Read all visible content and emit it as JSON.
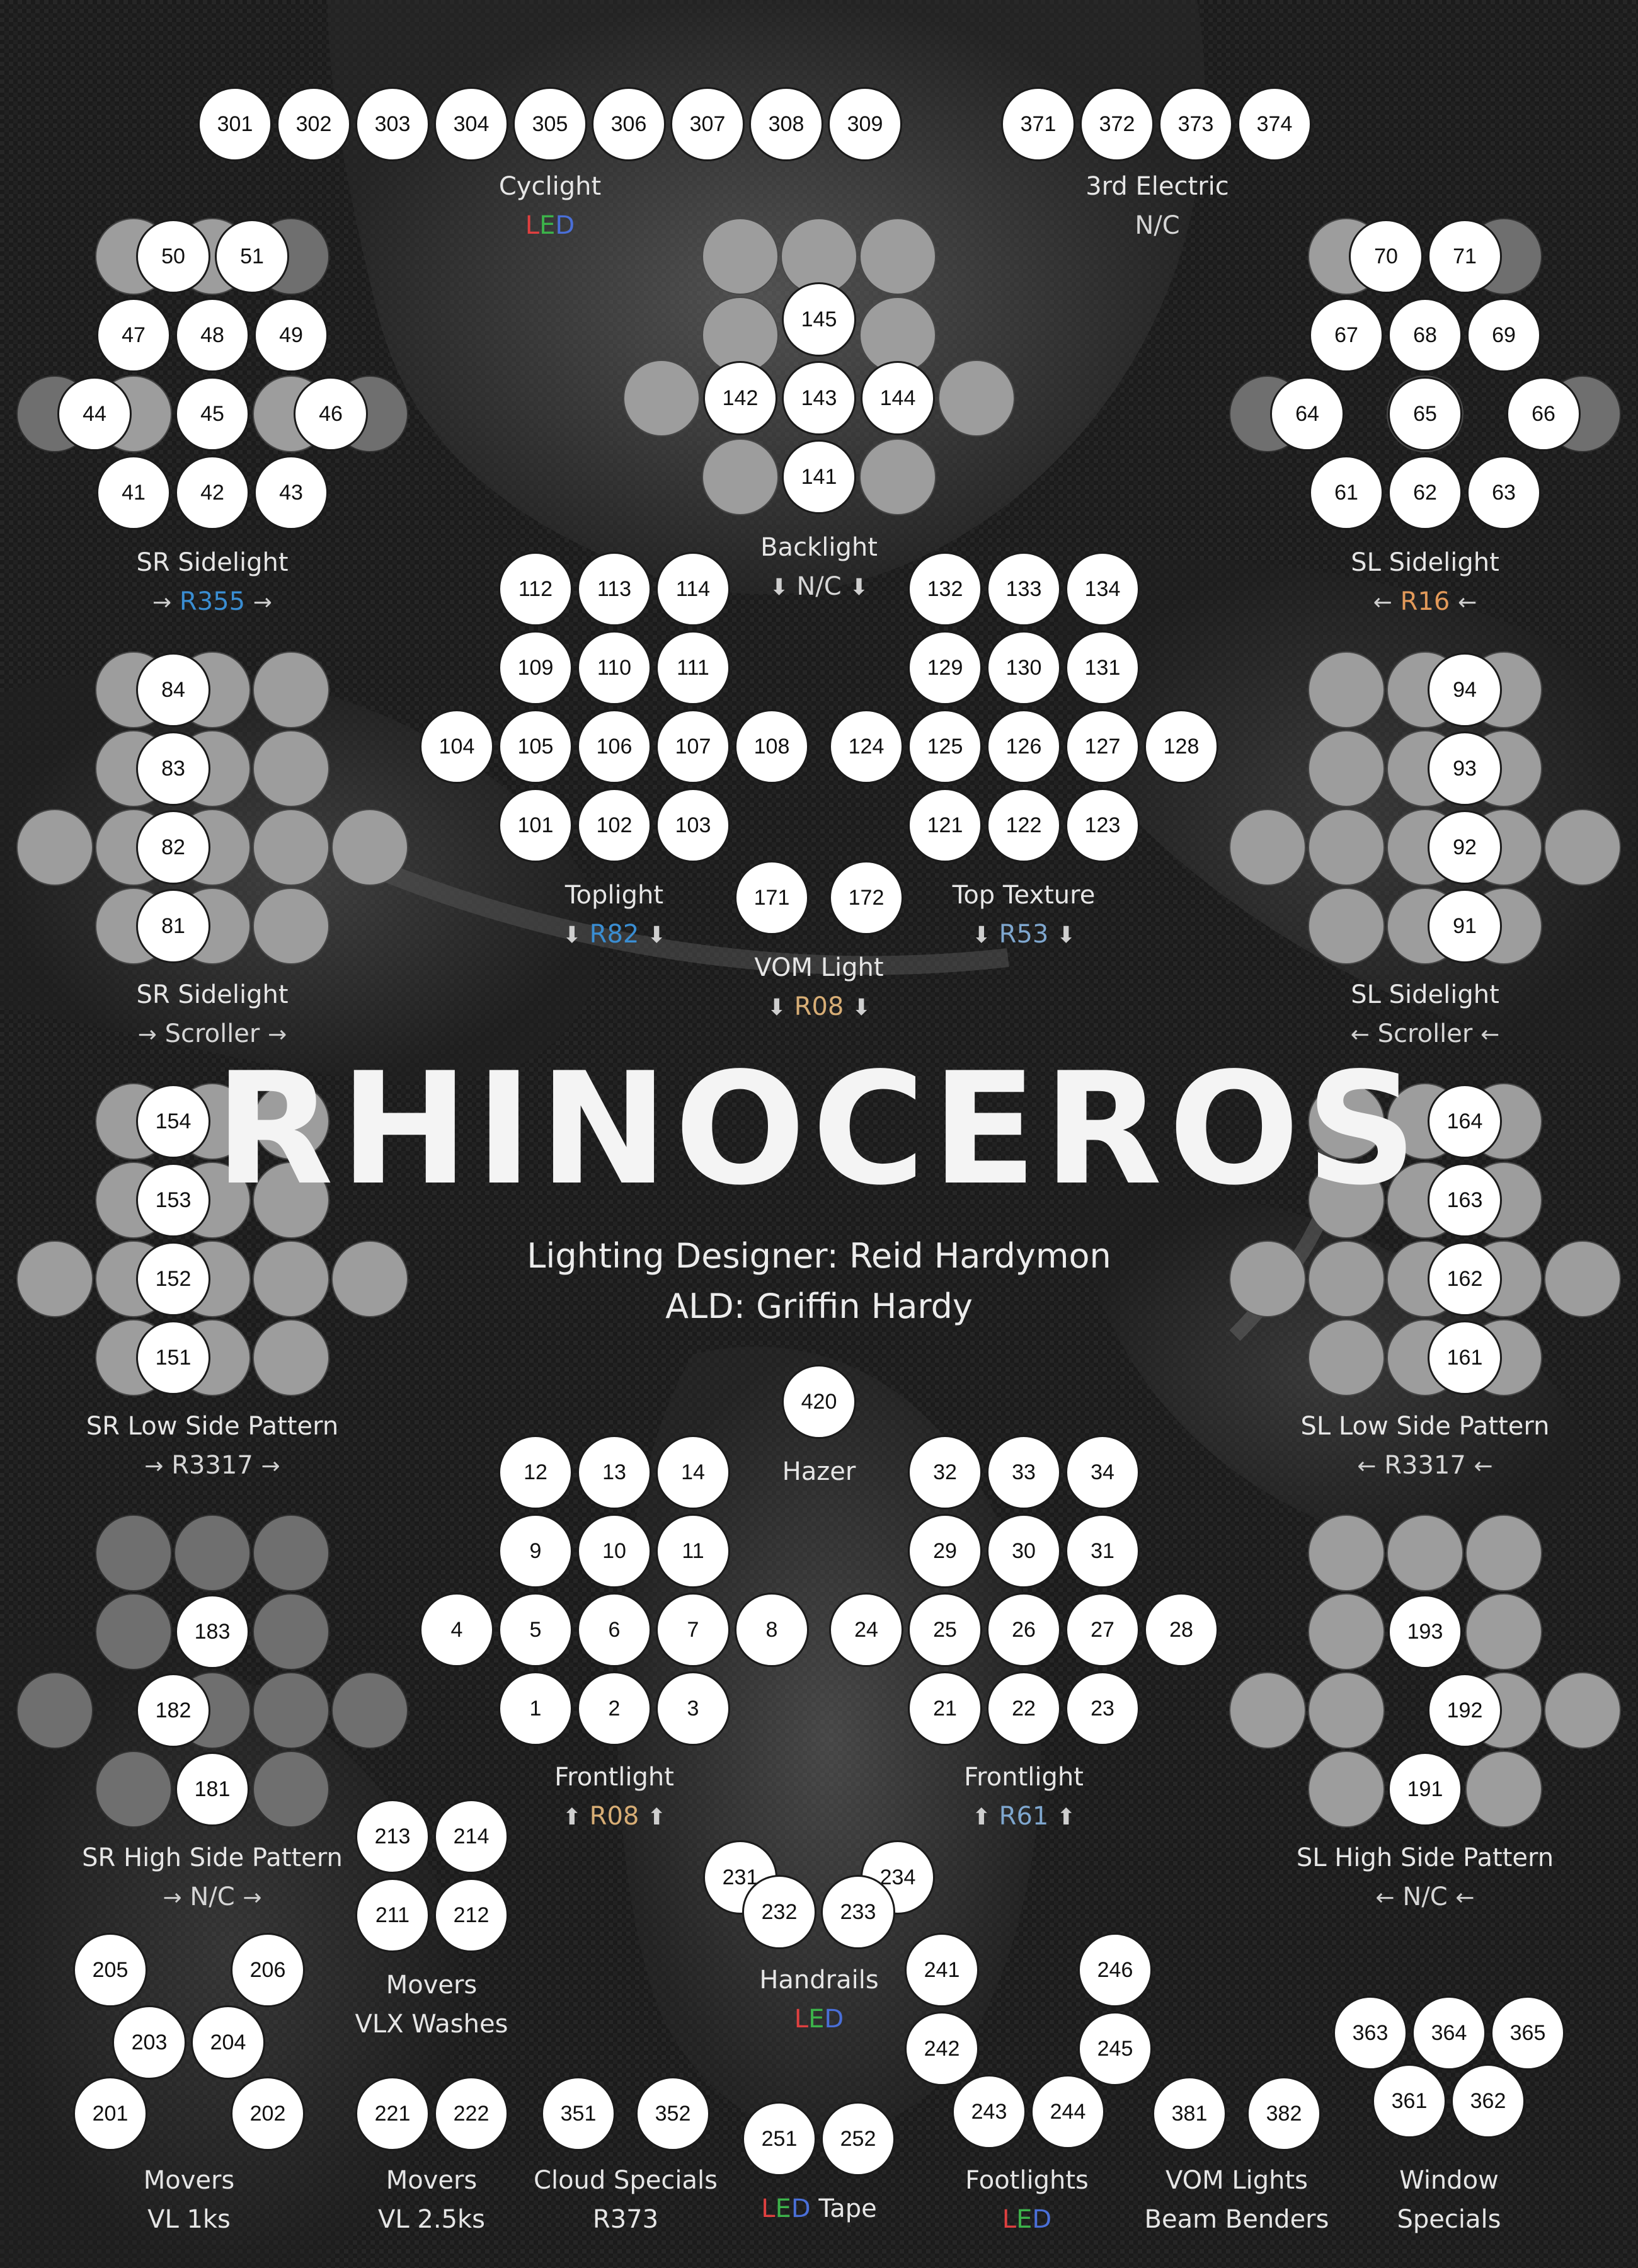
{
  "title": "RHINOCEROS",
  "credits": {
    "designer": "Lighting Designer: Reid Hardymon",
    "ald": "ALD: Griffin Hardy"
  },
  "colors": {
    "led_red": "#e04040",
    "led_green": "#3cb34a",
    "led_blue": "#4a6fd8",
    "gel_blue": "#3a8ed3",
    "gel_orange": "#e39a5a",
    "gel_gold": "#d8ae76",
    "gel_steel": "#7fa7cf"
  },
  "icons": {
    "arrow_right": "→",
    "arrow_left": "←",
    "arrow_down": "⬇",
    "arrow_up": "⬆"
  },
  "channels": [
    "301",
    "302",
    "303",
    "304",
    "305",
    "306",
    "307",
    "308",
    "309",
    "371",
    "372",
    "373",
    "374",
    "50",
    "51",
    "47",
    "48",
    "49",
    "44",
    "45",
    "46",
    "41",
    "42",
    "43",
    "145",
    "142",
    "143",
    "144",
    "141",
    "70",
    "71",
    "67",
    "68",
    "69",
    "64",
    "65",
    "66",
    "61",
    "62",
    "63",
    "112",
    "113",
    "114",
    "109",
    "110",
    "111",
    "104",
    "105",
    "106",
    "107",
    "108",
    "101",
    "102",
    "103",
    "132",
    "133",
    "134",
    "129",
    "130",
    "131",
    "124",
    "125",
    "126",
    "127",
    "128",
    "121",
    "122",
    "123",
    "84",
    "83",
    "82",
    "81",
    "94",
    "93",
    "92",
    "91",
    "171",
    "172",
    "154",
    "153",
    "152",
    "151",
    "164",
    "163",
    "162",
    "161",
    "420",
    "12",
    "13",
    "14",
    "9",
    "10",
    "11",
    "4",
    "5",
    "6",
    "7",
    "8",
    "1",
    "2",
    "3",
    "32",
    "33",
    "34",
    "29",
    "30",
    "31",
    "24",
    "25",
    "26",
    "27",
    "28",
    "21",
    "22",
    "23",
    "183",
    "182",
    "181",
    "193",
    "192",
    "191",
    "213",
    "214",
    "211",
    "212",
    "231",
    "234",
    "232",
    "233",
    "205",
    "206",
    "203",
    "204",
    "201",
    "202",
    "241",
    "246",
    "242",
    "245",
    "243",
    "244",
    "221",
    "222",
    "351",
    "352",
    "251",
    "252",
    "381",
    "382",
    "363",
    "364",
    "365",
    "361",
    "362"
  ],
  "labels": {
    "cyclight": {
      "name": "Cyclight",
      "led": [
        "L",
        "E",
        "D"
      ]
    },
    "third_electric": {
      "name": "3rd Electric",
      "gel": "N/C"
    },
    "sr_sidelight_top": {
      "name": "SR Sidelight",
      "gel": "R355"
    },
    "backlight": {
      "name": "Backlight",
      "gel": "N/C"
    },
    "sl_sidelight_top": {
      "name": "SL Sidelight",
      "gel": "R16"
    },
    "toplight": {
      "name": "Toplight",
      "gel": "R82"
    },
    "top_texture": {
      "name": "Top Texture",
      "gel": "R53"
    },
    "vom_light": {
      "name": "VOM Light",
      "gel": "R08"
    },
    "sr_sidelight_scroller": {
      "name": "SR Sidelight",
      "gel": "Scroller"
    },
    "sl_sidelight_scroller": {
      "name": "SL Sidelight",
      "gel": "Scroller"
    },
    "sr_low_side": {
      "name": "SR Low Side Pattern",
      "gel": "R3317"
    },
    "sl_low_side": {
      "name": "SL Low Side Pattern",
      "gel": "R3317"
    },
    "hazer": {
      "name": "Hazer"
    },
    "frontlight_sr": {
      "name": "Frontlight",
      "gel": "R08"
    },
    "frontlight_sl": {
      "name": "Frontlight",
      "gel": "R61"
    },
    "sr_high_side": {
      "name": "SR High Side Pattern",
      "gel": "N/C"
    },
    "sl_high_side": {
      "name": "SL High Side Pattern",
      "gel": "N/C"
    },
    "movers_vlx": {
      "name": "Movers",
      "sub": "VLX Washes"
    },
    "handrails": {
      "name": "Handrails",
      "led": [
        "L",
        "E",
        "D"
      ]
    },
    "movers_vl1k": {
      "name": "Movers",
      "sub": "VL 1ks"
    },
    "movers_vl25k": {
      "name": "Movers",
      "sub": "VL 2.5ks"
    },
    "cloud_specials": {
      "name": "Cloud Specials",
      "sub": "R373"
    },
    "led_tape": {
      "led": [
        "L",
        "E",
        "D"
      ],
      "name": "Tape"
    },
    "footlights": {
      "name": "Footlights",
      "led": [
        "L",
        "E",
        "D"
      ]
    },
    "vom_lights": {
      "name": "VOM Lights",
      "sub": "Beam Benders"
    },
    "window_specials": {
      "name": "Window",
      "sub": "Specials"
    }
  }
}
